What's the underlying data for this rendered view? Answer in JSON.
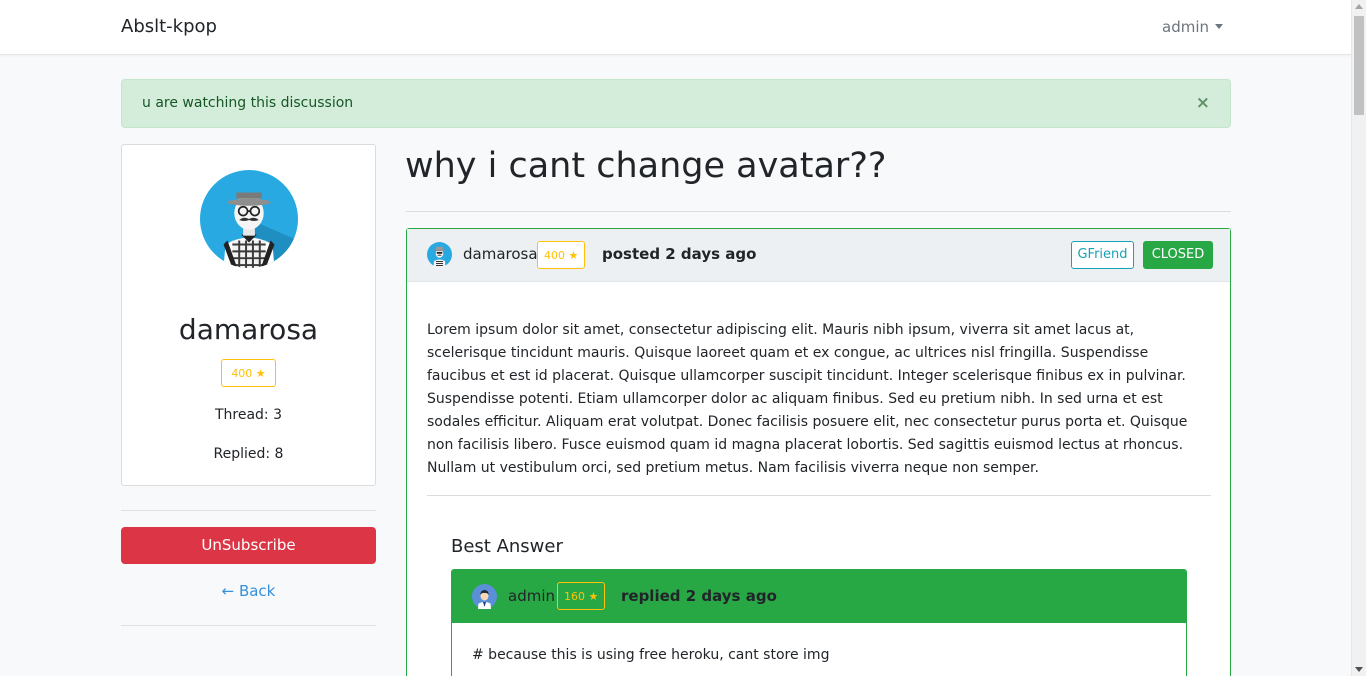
{
  "navbar": {
    "brand": "Abslt-kpop",
    "user": "admin"
  },
  "alert": {
    "message": "u are watching this discussion",
    "close": "×"
  },
  "profile": {
    "name": "damarosa",
    "reputation": "400 ★",
    "thread": "Thread: 3",
    "replied": "Replied: 8"
  },
  "sidebar": {
    "unsubscribe": "UnSubscribe",
    "back": "← Back"
  },
  "thread": {
    "title": "why i cant change avatar??",
    "author": "damarosa",
    "reputation": "400 ★",
    "posted": "posted 2 days ago",
    "category": "GFriend",
    "status": "CLOSED",
    "body": "Lorem ipsum dolor sit amet, consectetur adipiscing elit. Mauris nibh ipsum, viverra sit amet lacus at, scelerisque tincidunt mauris. Quisque laoreet quam et ex congue, ac ultrices nisl fringilla. Suspendisse faucibus et est id placerat. Quisque ullamcorper suscipit tincidunt. Integer scelerisque finibus ex in pulvinar. Suspendisse potenti. Etiam ullamcorper dolor ac aliquam finibus. Sed eu pretium nibh. In sed urna et est sodales efficitur. Aliquam erat volutpat. Donec facilisis posuere elit, nec consectetur purus porta et. Quisque non facilisis libero. Fusce euismod quam id magna placerat lobortis. Sed sagittis euismod lectus at rhoncus. Nullam ut vestibulum orci, sed pretium metus. Nam facilisis viverra neque non semper."
  },
  "best_answer": {
    "label": "Best Answer",
    "author": "admin",
    "reputation": "160 ★",
    "replied": "replied 2 days ago",
    "body": "# because this is using free heroku, cant store img"
  },
  "colors": {
    "success": "#28a745",
    "danger": "#dc3545",
    "warning": "#ffc107",
    "info": "#17a2b8",
    "link": "#3490dc"
  }
}
